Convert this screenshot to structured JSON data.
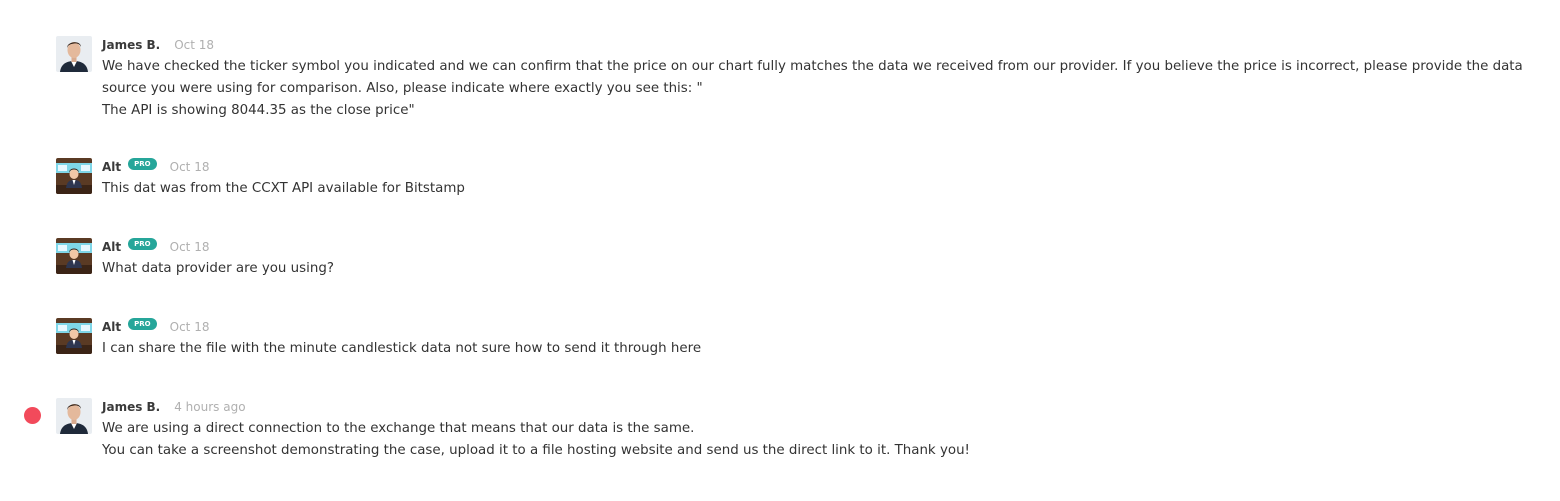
{
  "messages": [
    {
      "author": "James B.",
      "date": "Oct 18",
      "avatar": "man-portrait-avatar",
      "pro": false,
      "lines": [
        "We have checked the ticker symbol you indicated and we can confirm that the price on our chart fully matches the data we received from our provider. If you believe the price is incorrect, please provide the data source you were using for comparison. Also, please indicate where exactly you see this: \"",
        "The API is showing 8044.35 as the close price\""
      ]
    },
    {
      "author": "Alt",
      "badge": "PRO",
      "date": "Oct 18",
      "avatar": "cartoon-news-anchor-avatar",
      "pro": true,
      "lines": [
        "This dat was from the CCXT API available for Bitstamp"
      ]
    },
    {
      "author": "Alt",
      "badge": "PRO",
      "date": "Oct 18",
      "avatar": "cartoon-news-anchor-avatar",
      "pro": true,
      "lines": [
        "What data provider are you using?"
      ]
    },
    {
      "author": "Alt",
      "badge": "PRO",
      "date": "Oct 18",
      "avatar": "cartoon-news-anchor-avatar",
      "pro": true,
      "lines": [
        "I can share the file with the minute candlestick data not sure how to send it through here"
      ]
    },
    {
      "author": "James B.",
      "date": "4 hours ago",
      "avatar": "man-portrait-avatar",
      "pro": false,
      "unread": true,
      "lines": [
        "We are using a direct connection to the exchange that means that our data is the same.",
        "You can take a screenshot demonstrating the case, upload it to a file hosting website and send us the direct link to it. Thank you!"
      ]
    }
  ],
  "colors": {
    "pro_badge": "#26a69a",
    "unread_dot": "#f24a5b",
    "date_text": "#b0b0b0",
    "body_text": "#333333"
  }
}
